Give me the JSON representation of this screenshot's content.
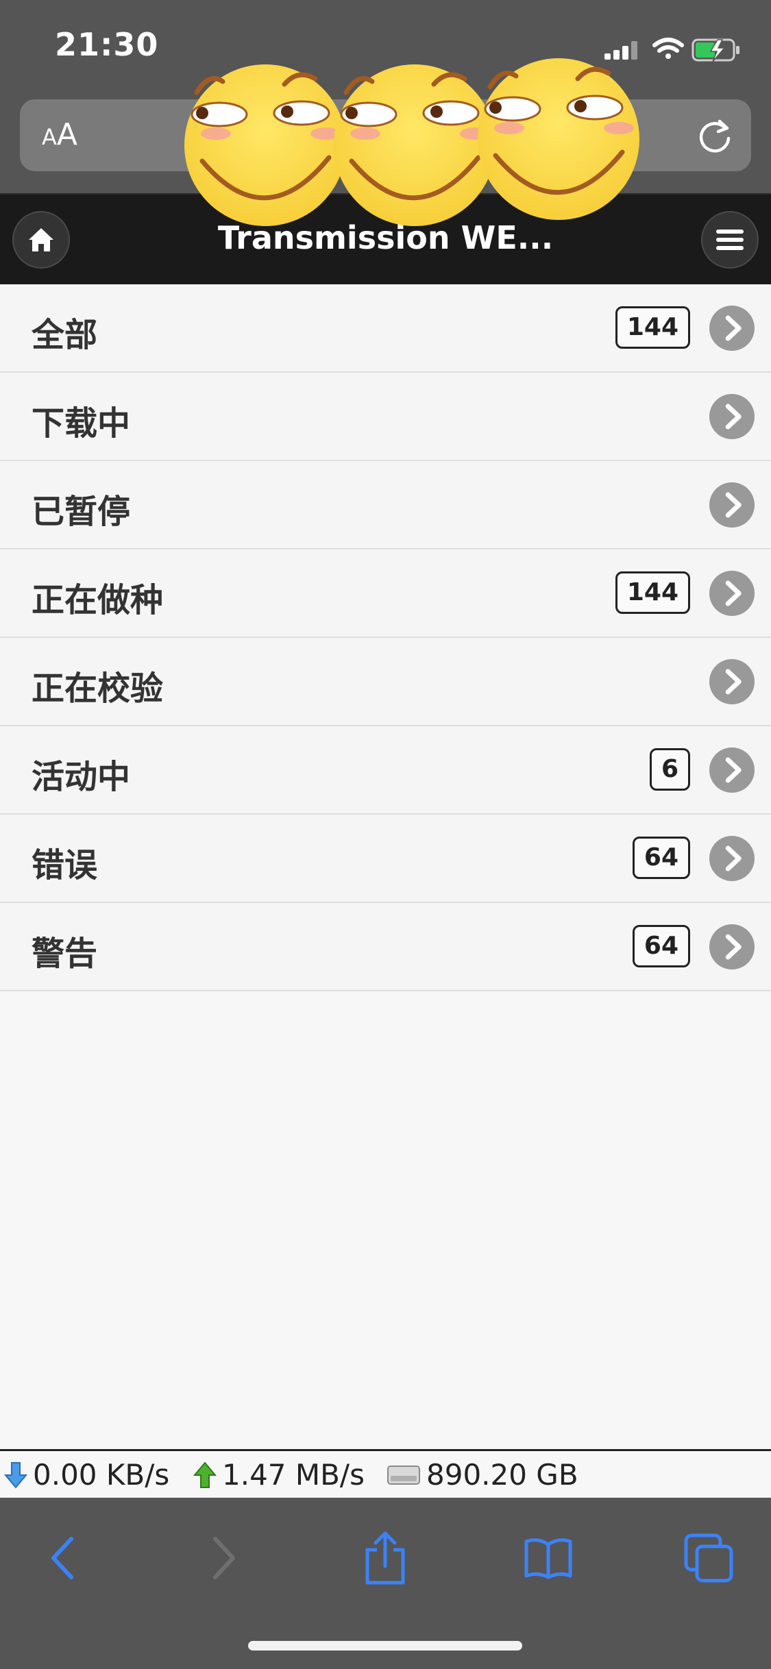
{
  "status_bar": {
    "time": "21:30"
  },
  "address_bar": {
    "aa_label_small": "A",
    "aa_label_large": "A"
  },
  "header": {
    "title": "Transmission WE..."
  },
  "filters": [
    {
      "label": "全部",
      "count": "144"
    },
    {
      "label": "下载中",
      "count": null
    },
    {
      "label": "已暂停",
      "count": null
    },
    {
      "label": "正在做种",
      "count": "144"
    },
    {
      "label": "正在校验",
      "count": null
    },
    {
      "label": "活动中",
      "count": "6"
    },
    {
      "label": "错误",
      "count": "64"
    },
    {
      "label": "警告",
      "count": "64"
    }
  ],
  "stats": {
    "download_speed": "0.00 KB/s",
    "upload_speed": "1.47 MB/s",
    "free_space": "890.20 GB"
  },
  "colors": {
    "chrome_gray": "#555555",
    "header_bg": "#1a1a1a",
    "safari_blue": "#3b82f6",
    "battery_green": "#34c759",
    "chevron_gray": "#999999"
  },
  "icons": {
    "status": [
      "cellular-signal-icon",
      "wifi-icon",
      "battery-charging-icon"
    ],
    "toolbar": [
      "back-icon",
      "forward-icon",
      "share-icon",
      "bookmarks-icon",
      "tabs-icon"
    ]
  }
}
